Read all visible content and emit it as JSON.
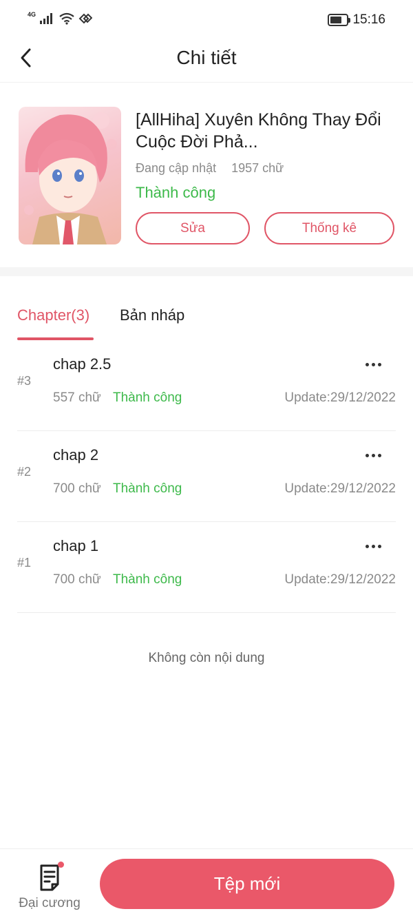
{
  "status_bar": {
    "network": "4G",
    "time": "15:16",
    "battery_level": 0.6
  },
  "header": {
    "title": "Chi tiết"
  },
  "book": {
    "title": "[AllHiha] Xuyên Không Thay Đổi Cuộc Đời Phả...",
    "update_status": "Đang cập nhật",
    "word_count": "1957 chữ",
    "status": "Thành công",
    "edit_label": "Sửa",
    "stats_label": "Thống kê"
  },
  "tabs": {
    "chapter_label": "Chapter(3)",
    "draft_label": "Bản nháp"
  },
  "chapters": [
    {
      "index": "#3",
      "name": "chap 2.5",
      "words": "557 chữ",
      "status": "Thành công",
      "update": "Update:29/12/2022"
    },
    {
      "index": "#2",
      "name": "chap 2",
      "words": "700 chữ",
      "status": "Thành công",
      "update": "Update:29/12/2022"
    },
    {
      "index": "#1",
      "name": "chap 1",
      "words": "700 chữ",
      "status": "Thành công",
      "update": "Update:29/12/2022"
    }
  ],
  "list_end_text": "Không còn nội dung",
  "bottom_bar": {
    "outline_label": "Đại cương",
    "new_file_label": "Tệp mới"
  },
  "colors": {
    "accent": "#ea5869",
    "success": "#3db94a",
    "muted": "#8a8a8a"
  },
  "icons": [
    "signal-icon",
    "wifi-icon",
    "hotspot-icon",
    "battery-icon",
    "back-arrow-icon",
    "more-icon",
    "outline-document-icon"
  ]
}
